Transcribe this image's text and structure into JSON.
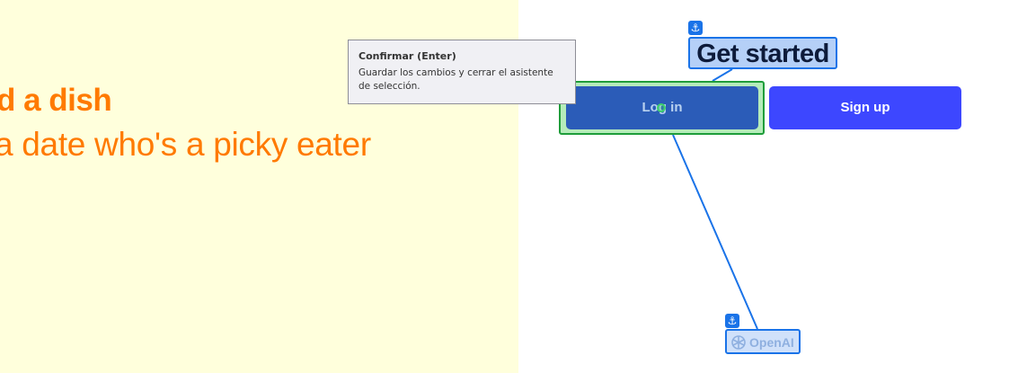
{
  "hero": {
    "headline": "d a dish",
    "subline": "a date who's a picky eater"
  },
  "auth": {
    "title": "Get started",
    "login_label": "Log in",
    "signup_label": "Sign up"
  },
  "footer": {
    "logo_text": "OpenAI"
  },
  "tooltip": {
    "title": "Confirmar (Enter)",
    "body": "Guardar los cambios y cerrar el asistente de selección."
  },
  "colors": {
    "hero_background": "#ffffdc",
    "hero_text": "#ff7a00",
    "login_button": "#2b5cb8",
    "signup_button": "#3d47ff",
    "anchor_highlight": "#1a73e8",
    "selection_highlight": "#1f9d3a"
  },
  "icons": {
    "anchor": "anchor-icon",
    "logo": "openai-logo-icon",
    "cursor": "cursor-indicator-icon"
  }
}
